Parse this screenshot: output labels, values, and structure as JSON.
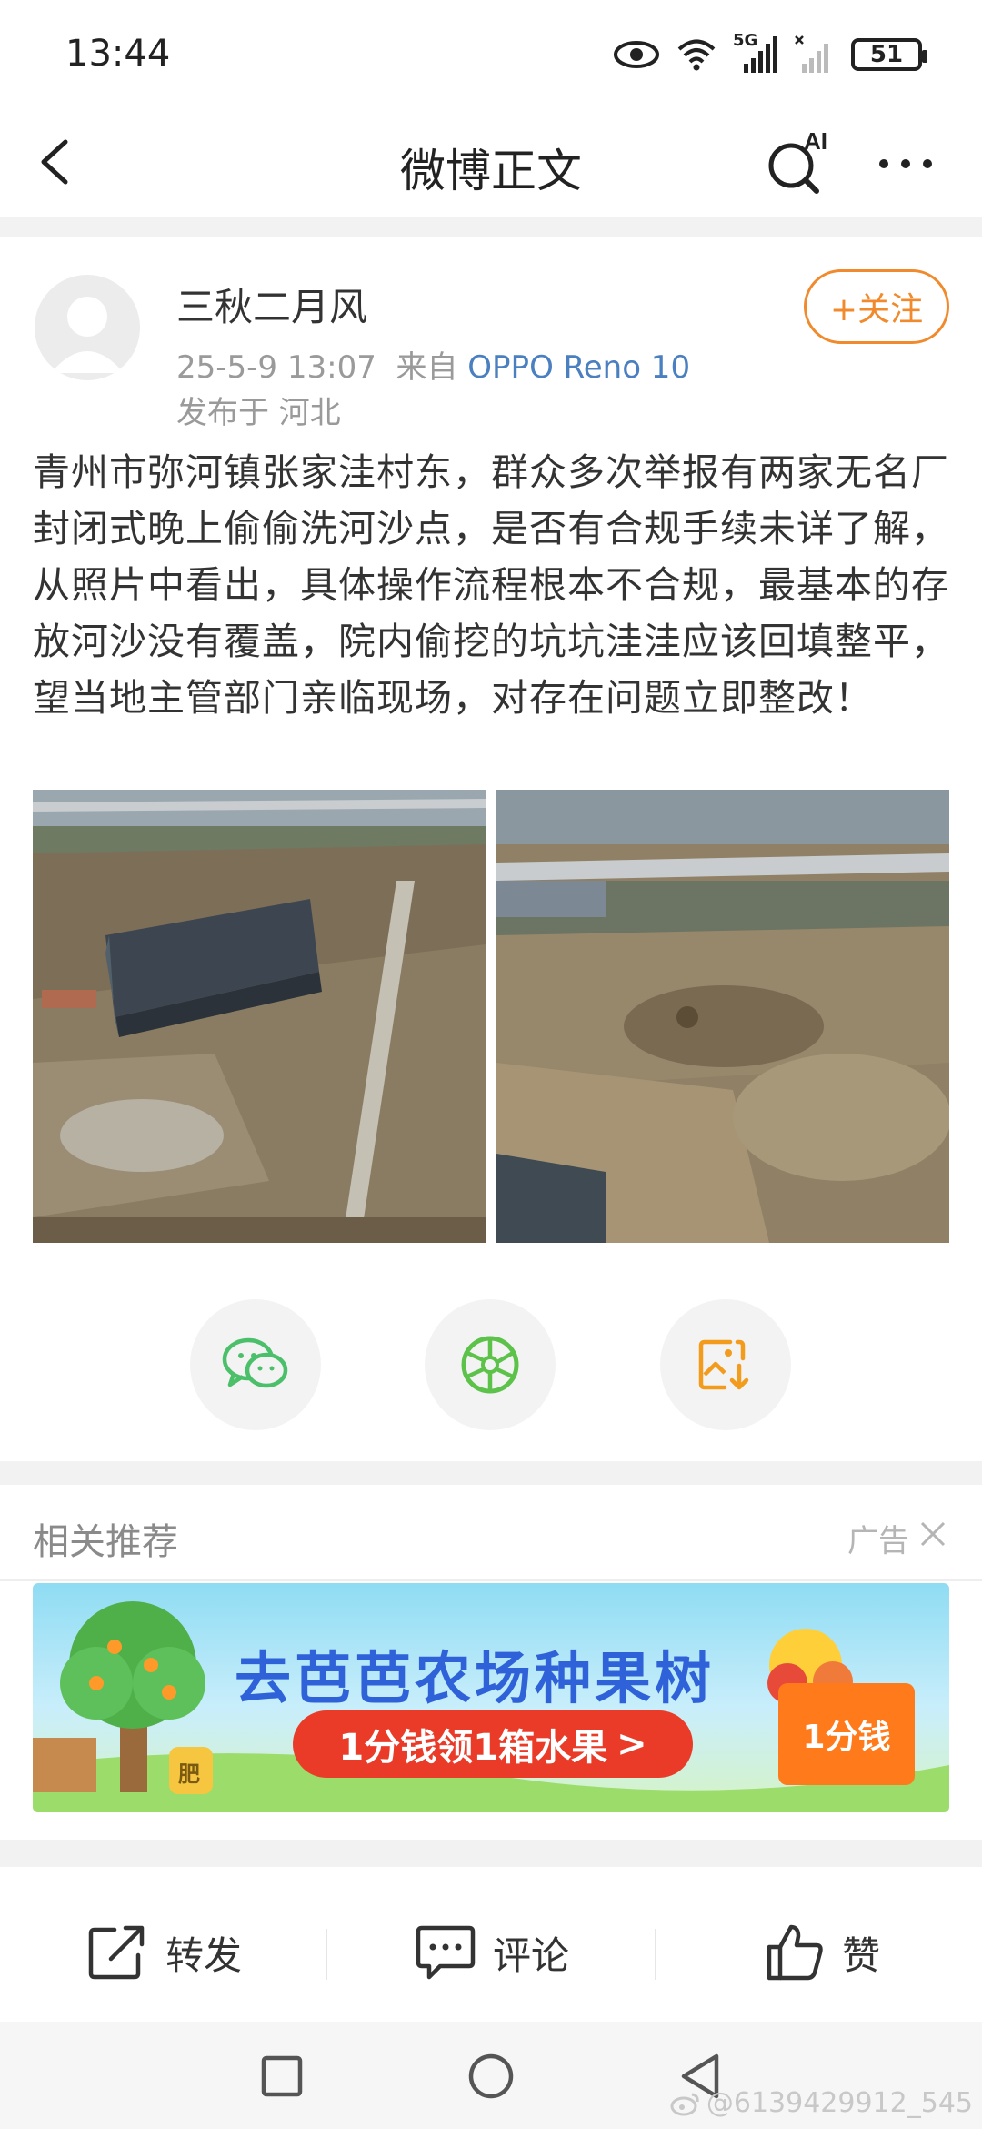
{
  "status_bar": {
    "time": "13:44",
    "network": "5G",
    "battery": "51"
  },
  "nav": {
    "title": "微博正文",
    "ai_label": "AI"
  },
  "post": {
    "author": "三秋二月风",
    "date": "25-5-9 13:07",
    "from_label": "来自",
    "device": "OPPO Reno 10",
    "location": "发布于 河北",
    "follow_label": "+关注",
    "text": "青州市弥河镇张家洼村东，群众多次举报有两家无名厂封闭式晚上偷偷洗河沙点，是否有合规手续未详了解，从照片中看出，具体操作流程根本不合规，最基本的存放河沙没有覆盖，院内偷挖的坑坑洼洼应该回填整平，望当地主管部门亲临现场，对存在问题立即整改！"
  },
  "share": [
    {
      "icon": "wechat-icon",
      "color": "#4cbf6b"
    },
    {
      "icon": "moments-icon",
      "color": "#5cc24a"
    },
    {
      "icon": "save-image-icon",
      "color": "#f29b1d"
    }
  ],
  "recommend": {
    "title": "相关推荐",
    "ad_label": "广告"
  },
  "ad": {
    "headline": "去芭芭农场种果树",
    "cta": "1分钱领1箱水果",
    "cta_arrow": ">",
    "price_tag": "1分钱",
    "pot_label": "肥"
  },
  "actions": {
    "repost": "转发",
    "comment": "评论",
    "like": "赞"
  },
  "watermark": "@6139429912_545",
  "colors": {
    "accent": "#f08a2c",
    "link": "#4a7fc0",
    "ad_headline": "#2f62d8",
    "ad_cta": "#ea3b28"
  }
}
